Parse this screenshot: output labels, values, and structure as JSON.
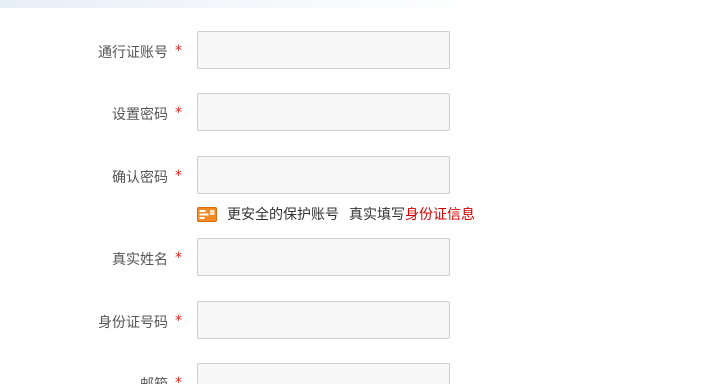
{
  "form": {
    "fields": [
      {
        "label": "通行证账号",
        "required": "*",
        "value": "",
        "placeholder": ""
      },
      {
        "label": "设置密码",
        "required": "*",
        "value": "",
        "placeholder": ""
      },
      {
        "label": "确认密码",
        "required": "*",
        "value": "",
        "placeholder": ""
      },
      {
        "label": "真实姓名",
        "required": "*",
        "value": "",
        "placeholder": ""
      },
      {
        "label": "身份证号码",
        "required": "*",
        "value": "",
        "placeholder": ""
      },
      {
        "label": "邮箱",
        "required": "*",
        "value": "",
        "placeholder": ""
      }
    ],
    "hint": {
      "icon": "id-card-icon",
      "text": "更安全的保护账号",
      "text2": "真实填写",
      "link": "身份证信息"
    }
  },
  "colors": {
    "required_star": "#e2231a",
    "link": "#d40000",
    "input_bg": "#f7f7f7",
    "input_border": "#cfcfcf",
    "label": "#555555",
    "hint_icon": "#f08a24"
  }
}
